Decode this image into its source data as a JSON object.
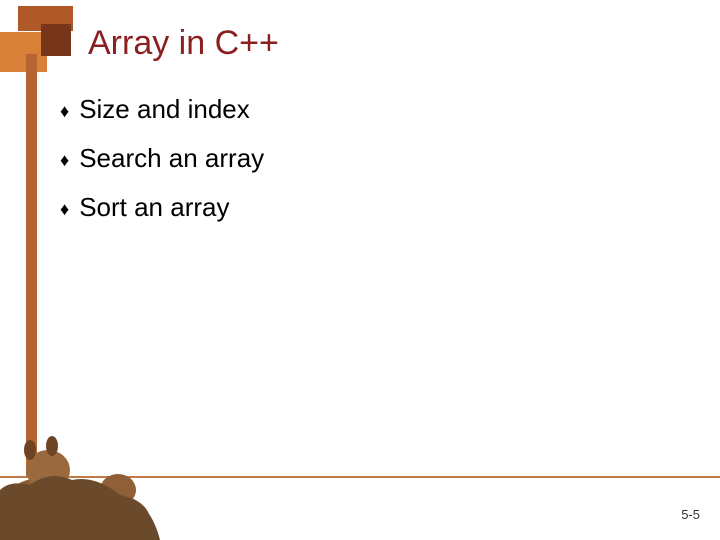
{
  "title": "Array in C++",
  "bullets": [
    "Size and index",
    "Search an array",
    "Sort an array"
  ],
  "page_number": "5-5",
  "colors": {
    "title": "#8b1f1f",
    "accent_orange": "#d88038",
    "accent_brown": "#77351a",
    "accent_tan": "#b05828",
    "left_bar": "#b56432",
    "footer_line": "#c07a46"
  }
}
